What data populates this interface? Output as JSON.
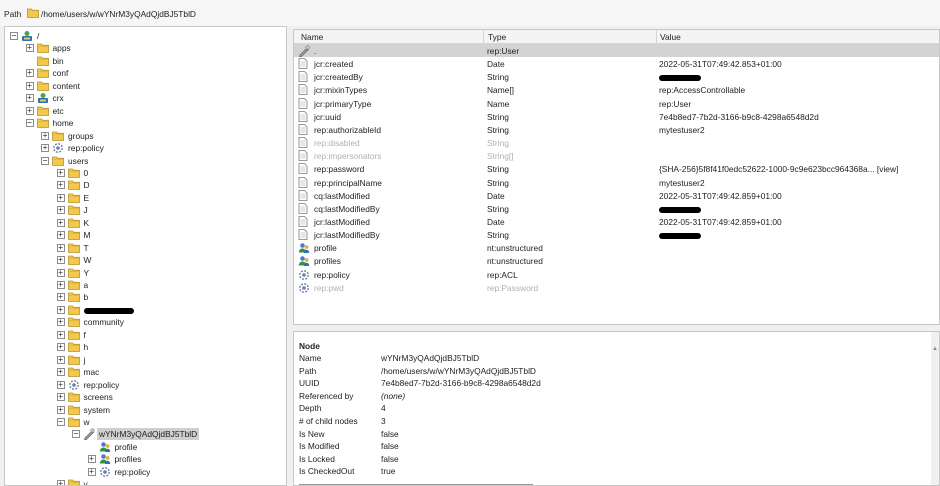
{
  "path": {
    "label": "Path",
    "value": "/home/users/w/wYNrM3yQAdQjdBJ5TblD"
  },
  "tree": [
    {
      "label": "/",
      "level": 0,
      "toggle": "-",
      "icon": "repo-icon"
    },
    {
      "label": "apps",
      "level": 1,
      "toggle": "+",
      "icon": "folder-icon"
    },
    {
      "label": "bin",
      "level": 1,
      "toggle": "",
      "icon": "folder-icon"
    },
    {
      "label": "conf",
      "level": 1,
      "toggle": "+",
      "icon": "folder-icon"
    },
    {
      "label": "content",
      "level": 1,
      "toggle": "+",
      "icon": "folder-icon"
    },
    {
      "label": "crx",
      "level": 1,
      "toggle": "+",
      "icon": "node-icon"
    },
    {
      "label": "etc",
      "level": 1,
      "toggle": "+",
      "icon": "folder-icon"
    },
    {
      "label": "home",
      "level": 1,
      "toggle": "-",
      "icon": "folder-icon"
    },
    {
      "label": "groups",
      "level": 2,
      "toggle": "+",
      "icon": "folder-icon"
    },
    {
      "label": "rep:policy",
      "level": 2,
      "toggle": "+",
      "icon": "policy-icon"
    },
    {
      "label": "users",
      "level": 2,
      "toggle": "-",
      "icon": "folder-icon"
    },
    {
      "label": "0",
      "level": 3,
      "toggle": "+",
      "icon": "folder-icon"
    },
    {
      "label": "D",
      "level": 3,
      "toggle": "+",
      "icon": "folder-icon"
    },
    {
      "label": "E",
      "level": 3,
      "toggle": "+",
      "icon": "folder-icon"
    },
    {
      "label": "J",
      "level": 3,
      "toggle": "+",
      "icon": "folder-icon"
    },
    {
      "label": "K",
      "level": 3,
      "toggle": "+",
      "icon": "folder-icon"
    },
    {
      "label": "M",
      "level": 3,
      "toggle": "+",
      "icon": "folder-icon"
    },
    {
      "label": "T",
      "level": 3,
      "toggle": "+",
      "icon": "folder-icon"
    },
    {
      "label": "W",
      "level": 3,
      "toggle": "+",
      "icon": "folder-icon"
    },
    {
      "label": "Y",
      "level": 3,
      "toggle": "+",
      "icon": "folder-icon"
    },
    {
      "label": "a",
      "level": 3,
      "toggle": "+",
      "icon": "folder-icon"
    },
    {
      "label": "b",
      "level": 3,
      "toggle": "+",
      "icon": "folder-icon"
    },
    {
      "label": "",
      "level": 3,
      "toggle": "+",
      "icon": "folder-icon",
      "redacted": true
    },
    {
      "label": "community",
      "level": 3,
      "toggle": "+",
      "icon": "folder-icon"
    },
    {
      "label": "f",
      "level": 3,
      "toggle": "+",
      "icon": "folder-icon"
    },
    {
      "label": "h",
      "level": 3,
      "toggle": "+",
      "icon": "folder-icon"
    },
    {
      "label": "j",
      "level": 3,
      "toggle": "+",
      "icon": "folder-icon"
    },
    {
      "label": "mac",
      "level": 3,
      "toggle": "+",
      "icon": "folder-icon"
    },
    {
      "label": "rep:policy",
      "level": 3,
      "toggle": "+",
      "icon": "policy-icon"
    },
    {
      "label": "screens",
      "level": 3,
      "toggle": "+",
      "icon": "folder-icon"
    },
    {
      "label": "system",
      "level": 3,
      "toggle": "+",
      "icon": "folder-icon"
    },
    {
      "label": "w",
      "level": 3,
      "toggle": "-",
      "icon": "folder-icon"
    },
    {
      "label": "wYNrM3yQAdQjdBJ5TblD",
      "level": 4,
      "toggle": "-",
      "icon": "user-icon",
      "selected": true
    },
    {
      "label": "profile",
      "level": 5,
      "toggle": "",
      "icon": "profile-icon"
    },
    {
      "label": "profiles",
      "level": 5,
      "toggle": "+",
      "icon": "profile-icon"
    },
    {
      "label": "rep:policy",
      "level": 5,
      "toggle": "+",
      "icon": "policy-icon"
    },
    {
      "label": "y",
      "level": 3,
      "toggle": "+",
      "icon": "folder-icon"
    }
  ],
  "properties": {
    "headers": {
      "name": "Name",
      "type": "Type",
      "value": "Value"
    },
    "rows": [
      {
        "name": ".",
        "type": "rep:User",
        "value": "",
        "icon": "user-icon",
        "selected": true
      },
      {
        "name": "jcr:created",
        "type": "Date",
        "value": "2022-05-31T07:49:42.853+01:00",
        "icon": "property-icon"
      },
      {
        "name": "jcr:createdBy",
        "type": "String",
        "value": "",
        "icon": "property-icon",
        "redacted": true
      },
      {
        "name": "jcr:mixinTypes",
        "type": "Name[]",
        "value": "rep:AccessControllable",
        "icon": "property-icon"
      },
      {
        "name": "jcr:primaryType",
        "type": "Name",
        "value": "rep:User",
        "icon": "property-icon"
      },
      {
        "name": "jcr:uuid",
        "type": "String",
        "value": "7e4b8ed7-7b2d-3166-b9c8-4298a6548d2d",
        "icon": "property-icon"
      },
      {
        "name": "rep:authorizableId",
        "type": "String",
        "value": "mytestuser2",
        "icon": "property-icon"
      },
      {
        "name": "rep:disabled",
        "type": "String",
        "value": "",
        "icon": "property-icon",
        "disabled": true
      },
      {
        "name": "rep:impersonators",
        "type": "String[]",
        "value": "",
        "icon": "property-icon",
        "disabled": true
      },
      {
        "name": "rep:password",
        "type": "String",
        "value": "{SHA-256}5f8f41f0edc52622-1000-9c9e623bcc964368a... [view]",
        "icon": "property-icon"
      },
      {
        "name": "rep:principalName",
        "type": "String",
        "value": "mytestuser2",
        "icon": "property-icon"
      },
      {
        "name": "cq:lastModified",
        "type": "Date",
        "value": "2022-05-31T07:49:42.859+01:00",
        "icon": "property-icon"
      },
      {
        "name": "cq:lastModifiedBy",
        "type": "String",
        "value": "",
        "icon": "property-icon",
        "redacted": true
      },
      {
        "name": "jcr:lastModified",
        "type": "Date",
        "value": "2022-05-31T07:49:42.859+01:00",
        "icon": "property-icon"
      },
      {
        "name": "jcr:lastModifiedBy",
        "type": "String",
        "value": "",
        "icon": "property-icon",
        "redacted": true
      },
      {
        "name": "profile",
        "type": "nt:unstructured",
        "value": "",
        "icon": "profile-icon"
      },
      {
        "name": "profiles",
        "type": "nt:unstructured",
        "value": "",
        "icon": "profile-icon"
      },
      {
        "name": "rep:policy",
        "type": "rep:ACL",
        "value": "",
        "icon": "policy-icon"
      },
      {
        "name": "rep:pwd",
        "type": "rep:Password",
        "value": "",
        "icon": "policy-icon",
        "disabled": true
      }
    ]
  },
  "node": {
    "title": "Node",
    "rows": [
      {
        "key": "Name",
        "value": "wYNrM3yQAdQjdBJ5TblD"
      },
      {
        "key": "Path",
        "value": "/home/users/w/wYNrM3yQAdQjdBJ5TblD"
      },
      {
        "key": "UUID",
        "value": "7e4b8ed7-7b2d-3166-b9c8-4298a6548d2d"
      },
      {
        "key": "Referenced by",
        "value": "(none)",
        "italic": true
      },
      {
        "key": "Depth",
        "value": "4"
      },
      {
        "key": "# of child nodes",
        "value": "3"
      },
      {
        "key": "Is New",
        "value": "false"
      },
      {
        "key": "Is Modified",
        "value": "false"
      },
      {
        "key": "Is Locked",
        "value": "false"
      },
      {
        "key": "Is CheckedOut",
        "value": "true"
      }
    ]
  }
}
